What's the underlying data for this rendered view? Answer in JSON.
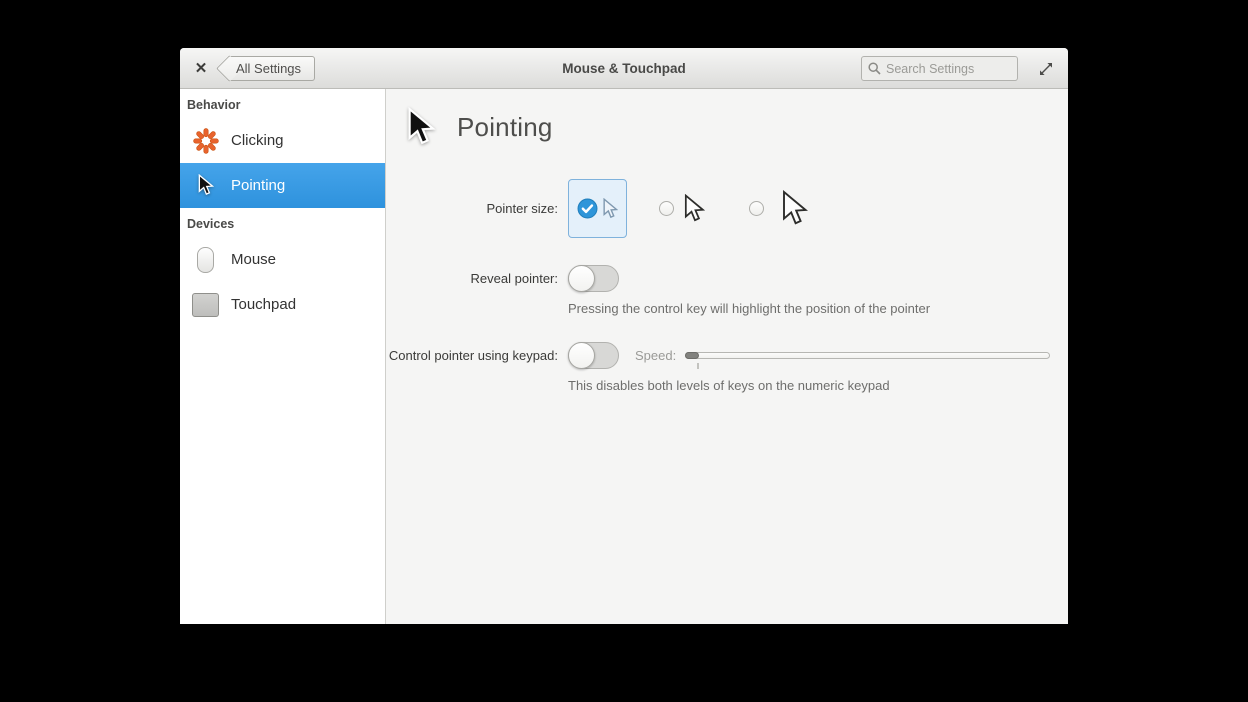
{
  "window": {
    "title": "Mouse & Touchpad",
    "close_glyph": "✕",
    "back_button": "All Settings",
    "search_placeholder": "Search Settings"
  },
  "sidebar": {
    "sections": [
      {
        "header": "Behavior",
        "items": [
          {
            "label": "Clicking",
            "icon": "clicking-spinner-icon",
            "selected": false
          },
          {
            "label": "Pointing",
            "icon": "pointer-cursor-icon",
            "selected": true
          }
        ]
      },
      {
        "header": "Devices",
        "items": [
          {
            "label": "Mouse",
            "icon": "mouse-icon",
            "selected": false
          },
          {
            "label": "Touchpad",
            "icon": "touchpad-icon",
            "selected": false
          }
        ]
      }
    ]
  },
  "main": {
    "heading": "Pointing",
    "pointer_size": {
      "label": "Pointer size:",
      "options": [
        "small",
        "medium",
        "large"
      ],
      "selected_index": 0
    },
    "reveal_pointer": {
      "label": "Reveal pointer:",
      "enabled": false,
      "description": "Pressing the control key will highlight the position of the pointer"
    },
    "keypad": {
      "label": "Control pointer using keypad:",
      "enabled": false,
      "speed_label": "Speed:",
      "speed_value": 0,
      "description": "This disables both levels of keys on the numeric keypad"
    }
  },
  "colors": {
    "selection_blue": "#3b9ce1",
    "check_blue": "#2e95d9",
    "clicking_orange": "#e8632d",
    "titlebar_gradient_top": "#f6f6f5",
    "titlebar_gradient_bottom": "#dcdcda",
    "sidebar_bg": "#ffffff",
    "content_bg": "#f5f5f4"
  }
}
